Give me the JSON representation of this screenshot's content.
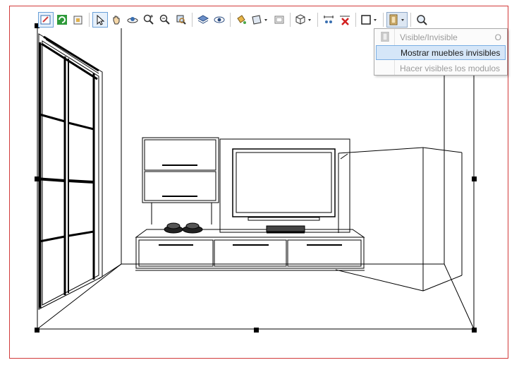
{
  "toolbar": {
    "buttons": [
      {
        "name": "edit-properties-icon"
      },
      {
        "name": "refresh-icon"
      },
      {
        "name": "library-icon"
      },
      {
        "name": "select-arrow-icon"
      },
      {
        "name": "pan-hand-icon"
      },
      {
        "name": "orbit-icon"
      },
      {
        "name": "zoom-in-icon"
      },
      {
        "name": "zoom-out-icon"
      },
      {
        "name": "zoom-window-icon"
      },
      {
        "name": "layers-icon"
      },
      {
        "name": "view-eye-icon"
      },
      {
        "name": "paint-bucket-icon"
      },
      {
        "name": "section-plane-icon"
      },
      {
        "name": "wireframe-icon"
      },
      {
        "name": "3d-box-icon"
      },
      {
        "name": "measure-icon"
      },
      {
        "name": "delete-measure-icon"
      },
      {
        "name": "rectangle-icon"
      },
      {
        "name": "visibility-door-icon"
      },
      {
        "name": "magnifier-icon"
      }
    ]
  },
  "menu": {
    "items": [
      {
        "label": "Visible/Invisible",
        "shortcut": "O",
        "state": "disabled"
      },
      {
        "label": "Mostrar muebles invisibles",
        "shortcut": "",
        "state": "highlighted"
      },
      {
        "label": "Hacer visibles los modulos",
        "shortcut": "",
        "state": "disabled"
      }
    ]
  },
  "colors": {
    "frame_border": "#d23a3a",
    "menu_highlight": "#d5e6f8",
    "menu_highlight_border": "#7aaee3",
    "disabled_text": "#9b9b9b"
  }
}
